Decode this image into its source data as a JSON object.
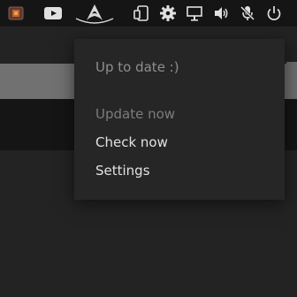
{
  "tray": {
    "icons": [
      "package-icon",
      "youtube-icon",
      "arch-update-icon",
      "phone-icon",
      "gear-icon",
      "display-icon",
      "volume-icon",
      "mic-muted-icon",
      "power-icon"
    ]
  },
  "menu": {
    "status": "Up to date :)",
    "update_now": "Update now",
    "check_now": "Check now",
    "settings": "Settings"
  },
  "colors": {
    "panel": "#151515",
    "menu_bg": "#262626",
    "text_active": "#e2e2e2",
    "text_disabled": "#7c7c7c"
  }
}
